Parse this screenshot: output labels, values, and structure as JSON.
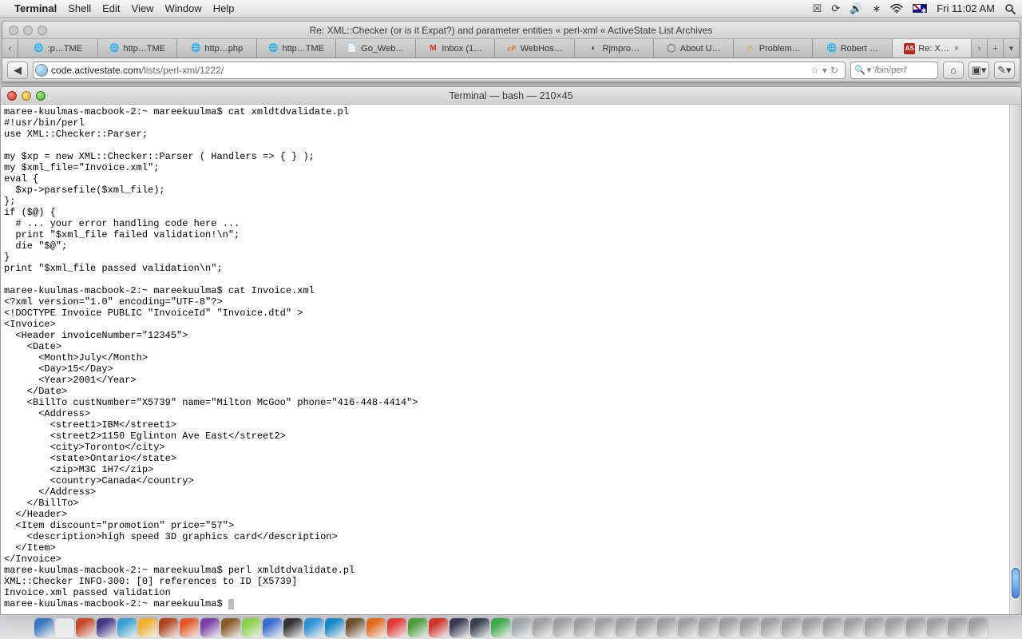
{
  "menubar": {
    "app": "Terminal",
    "items": [
      "Shell",
      "Edit",
      "View",
      "Window",
      "Help"
    ],
    "clock": "Fri 11:02 AM"
  },
  "safari": {
    "title": "Re: XML::Checker (or is it Expat?) and parameter entities « perl-xml « ActiveState List Archives",
    "url_domain": "code.activestate.com",
    "url_path": "/lists/perl-xml/1222/",
    "search_placeholder": "'/bin/perl'",
    "tabs": [
      {
        "label": ":p…TME",
        "favicon": "🌐"
      },
      {
        "label": "http…TME",
        "favicon": "🌐"
      },
      {
        "label": "http…php",
        "favicon": "🌐"
      },
      {
        "label": "http…TME",
        "favicon": "🌐"
      },
      {
        "label": "Go_Web…",
        "favicon": "📄"
      },
      {
        "label": "Inbox (1…",
        "favicon": "M"
      },
      {
        "label": "WebHos…",
        "favicon": "cP"
      },
      {
        "label": "Rjmpro…",
        "favicon": "◐"
      },
      {
        "label": "About U…",
        "favicon": "◯"
      },
      {
        "label": "Problem…",
        "favicon": "⚠"
      },
      {
        "label": "Robert …",
        "favicon": "🌐"
      },
      {
        "label": "Re: X…",
        "favicon": "AS",
        "active": true,
        "closable": true
      }
    ]
  },
  "terminal": {
    "title": "Terminal — bash — 210×45",
    "prompt": "maree-kuulmas-macbook-2:~ mareekuulma$ ",
    "content": "maree-kuulmas-macbook-2:~ mareekuulma$ cat xmldtdvalidate.pl\n#!usr/bin/perl\nuse XML::Checker::Parser;\n\nmy $xp = new XML::Checker::Parser ( Handlers => { } );\nmy $xml_file=\"Invoice.xml\";\neval {\n  $xp->parsefile($xml_file);\n};\nif ($@) {\n  # ... your error handling code here ...\n  print \"$xml_file failed validation!\\n\";\n  die \"$@\";\n}\nprint \"$xml_file passed validation\\n\";\n\nmaree-kuulmas-macbook-2:~ mareekuulma$ cat Invoice.xml\n<?xml version=\"1.0\" encoding=\"UTF-8\"?>\n<!DOCTYPE Invoice PUBLIC \"InvoiceId\" \"Invoice.dtd\" >\n<Invoice>\n  <Header invoiceNumber=\"12345\">\n    <Date>\n      <Month>July</Month>\n      <Day>15</Day>\n      <Year>2001</Year>\n    </Date>\n    <BillTo custNumber=\"X5739\" name=\"Milton McGoo\" phone=\"416-448-4414\">\n      <Address>\n        <street1>IBM</street1>\n        <street2>1150 Eglinton Ave East</street2>\n        <city>Toronto</city>\n        <state>Ontario</state>\n        <zip>M3C 1H7</zip>\n        <country>Canada</country>\n      </Address>\n    </BillTo>\n  </Header>\n  <Item discount=\"promotion\" price=\"57\">\n    <description>high speed 3D graphics card</description>\n  </Item>\n</Invoice>\nmaree-kuulmas-macbook-2:~ mareekuulma$ perl xmldtdvalidate.pl\nXML::Checker INFO-300: [0] references to ID [X5739]\nInvoice.xml passed validation\nmaree-kuulmas-macbook-2:~ mareekuulma$ "
  },
  "dock": {
    "colors": [
      "#3a78c2",
      "#e8e8e8",
      "#c84a2d",
      "#443a86",
      "#39a0d0",
      "#f0b030",
      "#b04820",
      "#e35a2a",
      "#7a40a5",
      "#8a5a2a",
      "#8ad14b",
      "#3c6ed0",
      "#333333",
      "#2f91d8",
      "#1889c8",
      "#6e4f30",
      "#e06a1f",
      "#e03a3a",
      "#4c9e3b",
      "#d1352a",
      "#3b3b55",
      "#3a4150",
      "#3fa94e",
      "#9ea4a8",
      "#a0a0a0",
      "#a0a0a0",
      "#a0a0a0",
      "#a0a0a0",
      "#a0a0a0",
      "#a0a0a0",
      "#a0a0a0",
      "#a0a0a0",
      "#a0a0a0",
      "#a0a0a0",
      "#a0a0a0",
      "#a0a0a0",
      "#a0a0a0",
      "#a0a0a0",
      "#a0a0a0",
      "#a0a0a0",
      "#a0a0a0",
      "#a0a0a0",
      "#a0a0a0",
      "#a0a0a0",
      "#a0a0a0",
      "#a0a0a0"
    ]
  }
}
